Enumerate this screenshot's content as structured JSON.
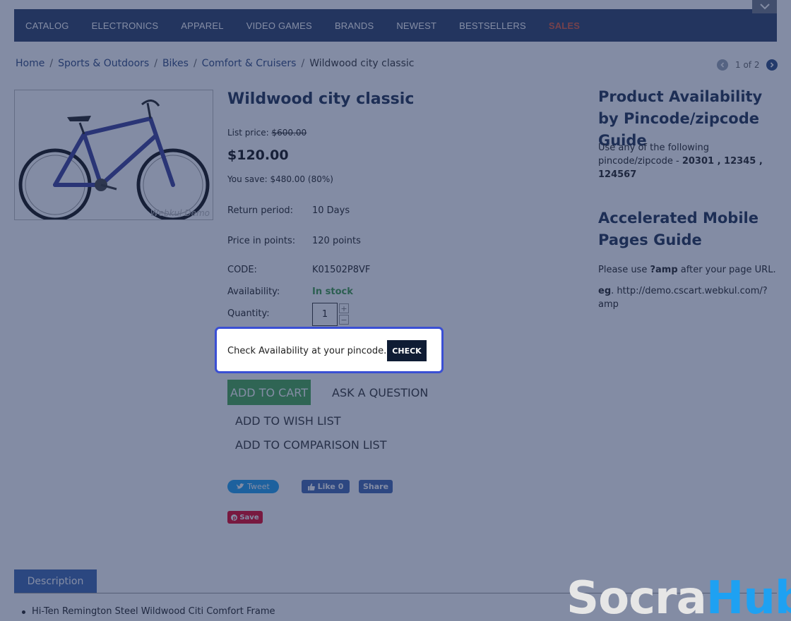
{
  "nav": {
    "items": [
      "CATALOG",
      "ELECTRONICS",
      "APPAREL",
      "VIDEO GAMES",
      "BRANDS",
      "NEWEST",
      "BESTSELLERS",
      "SALES"
    ]
  },
  "breadcrumb": {
    "items": [
      "Home",
      "Sports & Outdoors",
      "Bikes",
      "Comfort & Cruisers"
    ],
    "current": "Wildwood city classic",
    "separator": "/"
  },
  "pager": {
    "text": "1 of 2"
  },
  "product": {
    "image_watermark": "Webkul Demo",
    "title": "Wildwood city classic",
    "list_price_label": "List price:",
    "list_price": "$600.00",
    "price": "$120.00",
    "you_save": "You save: $480.00 (80%)",
    "return_label": "Return period:",
    "return_value": "10 Days",
    "points_label": "Price in points:",
    "points_value": "120 points",
    "code_label": "CODE:",
    "code_value": "K01502P8VF",
    "availability_label": "Availability:",
    "availability_value": "In stock",
    "quantity_label": "Quantity:",
    "quantity_value": "1",
    "qty_plus": "+",
    "qty_minus": "−"
  },
  "pincode": {
    "text": "Check Availability at your pincode.",
    "button": "CHECK"
  },
  "actions": {
    "add_to_cart": "ADD TO CART",
    "ask_question": "ASK A QUESTION",
    "wish_list": "ADD TO WISH LIST",
    "comparison": "ADD TO COMPARISON LIST"
  },
  "social": {
    "tweet": "Tweet",
    "like": "Like 0",
    "share": "Share",
    "save": "Save"
  },
  "side": {
    "guide1_title": "Product Availability by Pincode/zipcode Guide",
    "guide1_text": "Use any of the following pincode/zipcode -",
    "guide1_codes": "20301 , 12345 , 124567",
    "guide2_title": "Accelerated Mobile Pages Guide",
    "guide2_text_pre": "Please use",
    "guide2_text_bold": "?amp",
    "guide2_text_post": "after your page URL.",
    "eg_label": "eg",
    "eg_url": ". http://demo.cscart.webkul.com/?amp"
  },
  "tabs": {
    "description": "Description"
  },
  "description_items": [
    "Hi-Ten Remington Steel Wildwood Citi Comfort Frame"
  ],
  "logo": {
    "part1": "Socra",
    "part2": "Hub"
  },
  "colors": {
    "nav_bg": "#2c3e66",
    "sales": "#e05a3b",
    "add_cart": "#46a84e",
    "highlight_border": "#3a4fd4",
    "in_stock": "#3e9b48",
    "logo_hub": "#1ea1f2"
  }
}
